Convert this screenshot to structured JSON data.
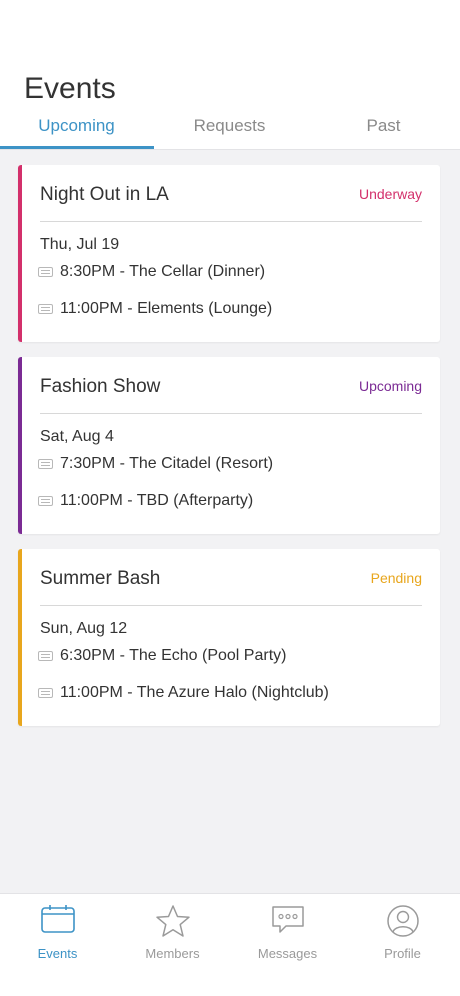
{
  "header": {
    "title": "Events",
    "tabs": [
      {
        "label": "Upcoming"
      },
      {
        "label": "Requests"
      },
      {
        "label": "Past"
      }
    ]
  },
  "colors": {
    "accent": "#3d93c6",
    "underway": "#d3306b",
    "upcoming": "#7b2b94",
    "pending": "#e8a61d"
  },
  "events": [
    {
      "title": "Night Out in LA",
      "status": "Underway",
      "date": "Thu, Jul 19",
      "items": [
        {
          "icon": "list-icon",
          "text": "8:30PM - The Cellar (Dinner)"
        },
        {
          "icon": "list-icon",
          "text": "11:00PM - Elements (Lounge)"
        }
      ]
    },
    {
      "title": "Fashion Show",
      "status": "Upcoming",
      "date": "Sat, Aug 4",
      "items": [
        {
          "icon": "list-icon",
          "text": "7:30PM - The Citadel (Resort)"
        },
        {
          "icon": "list-icon",
          "text": "11:00PM - TBD (Afterparty)"
        }
      ]
    },
    {
      "title": "Summer Bash",
      "status": "Pending",
      "date": "Sun, Aug 12",
      "items": [
        {
          "icon": "list-icon",
          "text": "6:30PM - The Echo (Pool Party)"
        },
        {
          "icon": "list-icon",
          "text": "11:00PM - The Azure Halo (Nightclub)"
        }
      ]
    }
  ],
  "nav": [
    {
      "label": "Events",
      "icon": "calendar-icon"
    },
    {
      "label": "Members",
      "icon": "star-icon"
    },
    {
      "label": "Messages",
      "icon": "chat-icon"
    },
    {
      "label": "Profile",
      "icon": "user-icon"
    }
  ]
}
